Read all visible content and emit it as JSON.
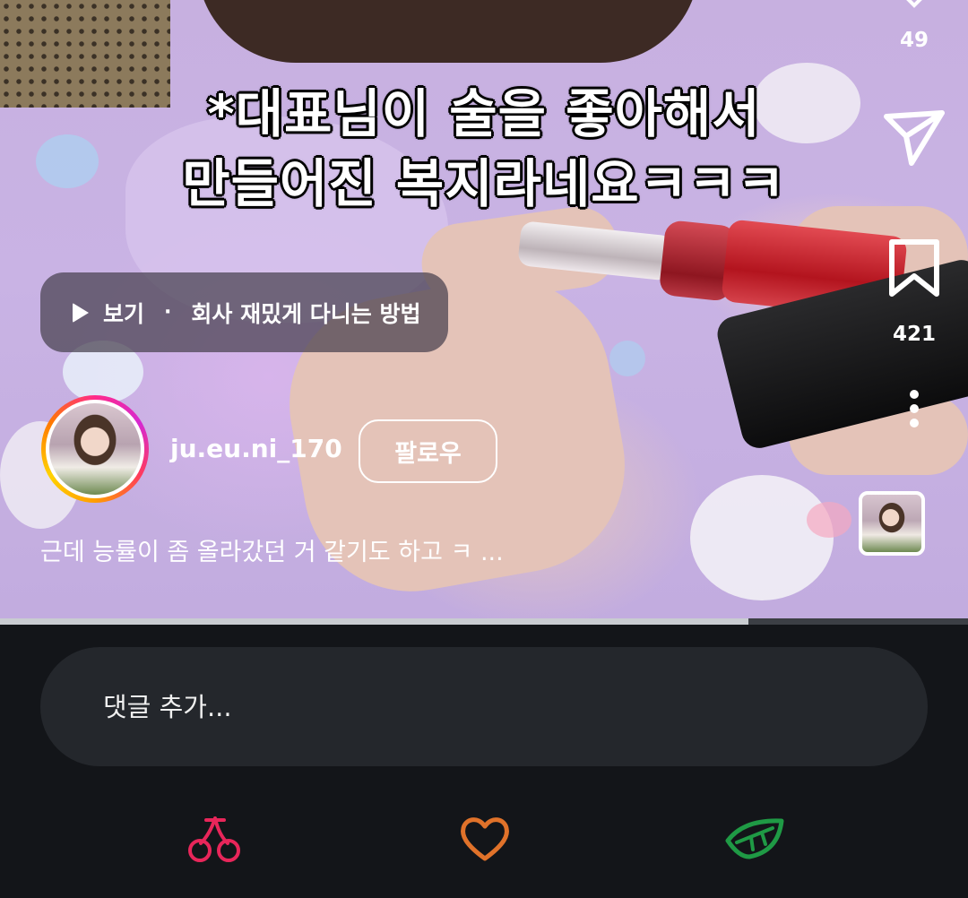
{
  "video": {
    "caption_line1": "*대표님이 술을 좋아해서",
    "caption_line2": "만들어진 복지라네요ㅋㅋㅋ",
    "progress_fraction": 0.773
  },
  "watch_chip": {
    "watch_label": "보기",
    "separator": "·",
    "series_title": "회사 재밌게 다니는 방법"
  },
  "user": {
    "username": "ju.eu.ni_170",
    "follow_label": "팔로우"
  },
  "post": {
    "caption_preview": "근데 능률이 좀 올라갔던 거 같기도 하고 ㅋ ..."
  },
  "actions": {
    "top_count": "49",
    "bookmark_count": "421"
  },
  "comment": {
    "placeholder": "댓글 추가..."
  },
  "nav": {
    "icons": [
      "cherry-icon",
      "heart-icon",
      "leaf-icon"
    ],
    "colors": {
      "cherry": "#e8265a",
      "heart": "#e0722a",
      "leaf": "#1f9a45"
    }
  }
}
